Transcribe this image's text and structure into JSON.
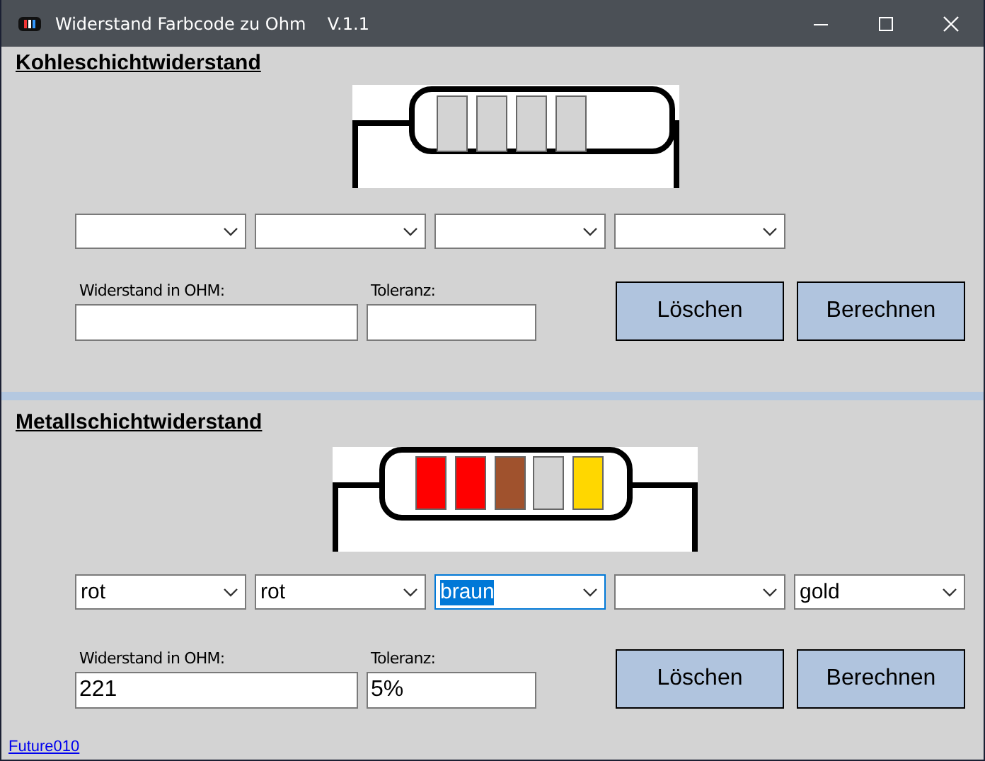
{
  "window": {
    "title": "Widerstand Farbcode zu Ohm    V.1.1"
  },
  "sections": [
    {
      "title": "Kohleschichtwiderstand",
      "bands": [
        {
          "color": "#d3d3d3"
        },
        {
          "color": "#d3d3d3"
        },
        {
          "color": "#d3d3d3"
        },
        {
          "color": "#d3d3d3"
        }
      ],
      "dropdowns": [
        {
          "focused": false
        },
        {
          "focused": false
        },
        {
          "focused": false
        },
        {
          "focused": false
        }
      ],
      "resistance": {
        "label": "Widerstand in OHM:"
      },
      "tolerance": {
        "label": "Toleranz:"
      },
      "buttons": [
        "Löschen",
        "Berechnen"
      ]
    },
    {
      "title": "Metallschichtwiderstand",
      "bands": [
        {
          "color": "#ff0000"
        },
        {
          "color": "#ff0000"
        },
        {
          "color": "#a0522d"
        },
        {
          "color": "#d3d3d3"
        },
        {
          "color": "#ffd700"
        }
      ],
      "dropdowns": [
        {
          "value": "rot",
          "focused": false
        },
        {
          "value": "rot",
          "focused": false
        },
        {
          "value": "braun",
          "focused": true
        },
        {
          "focused": false
        },
        {
          "value": "gold",
          "focused": false
        }
      ],
      "resistance": {
        "label": "Widerstand in OHM:",
        "value": "221"
      },
      "tolerance": {
        "label": "Toleranz:",
        "value": "5%"
      },
      "buttons": [
        "Löschen",
        "Berechnen"
      ]
    }
  ],
  "footer_link": "Future010"
}
